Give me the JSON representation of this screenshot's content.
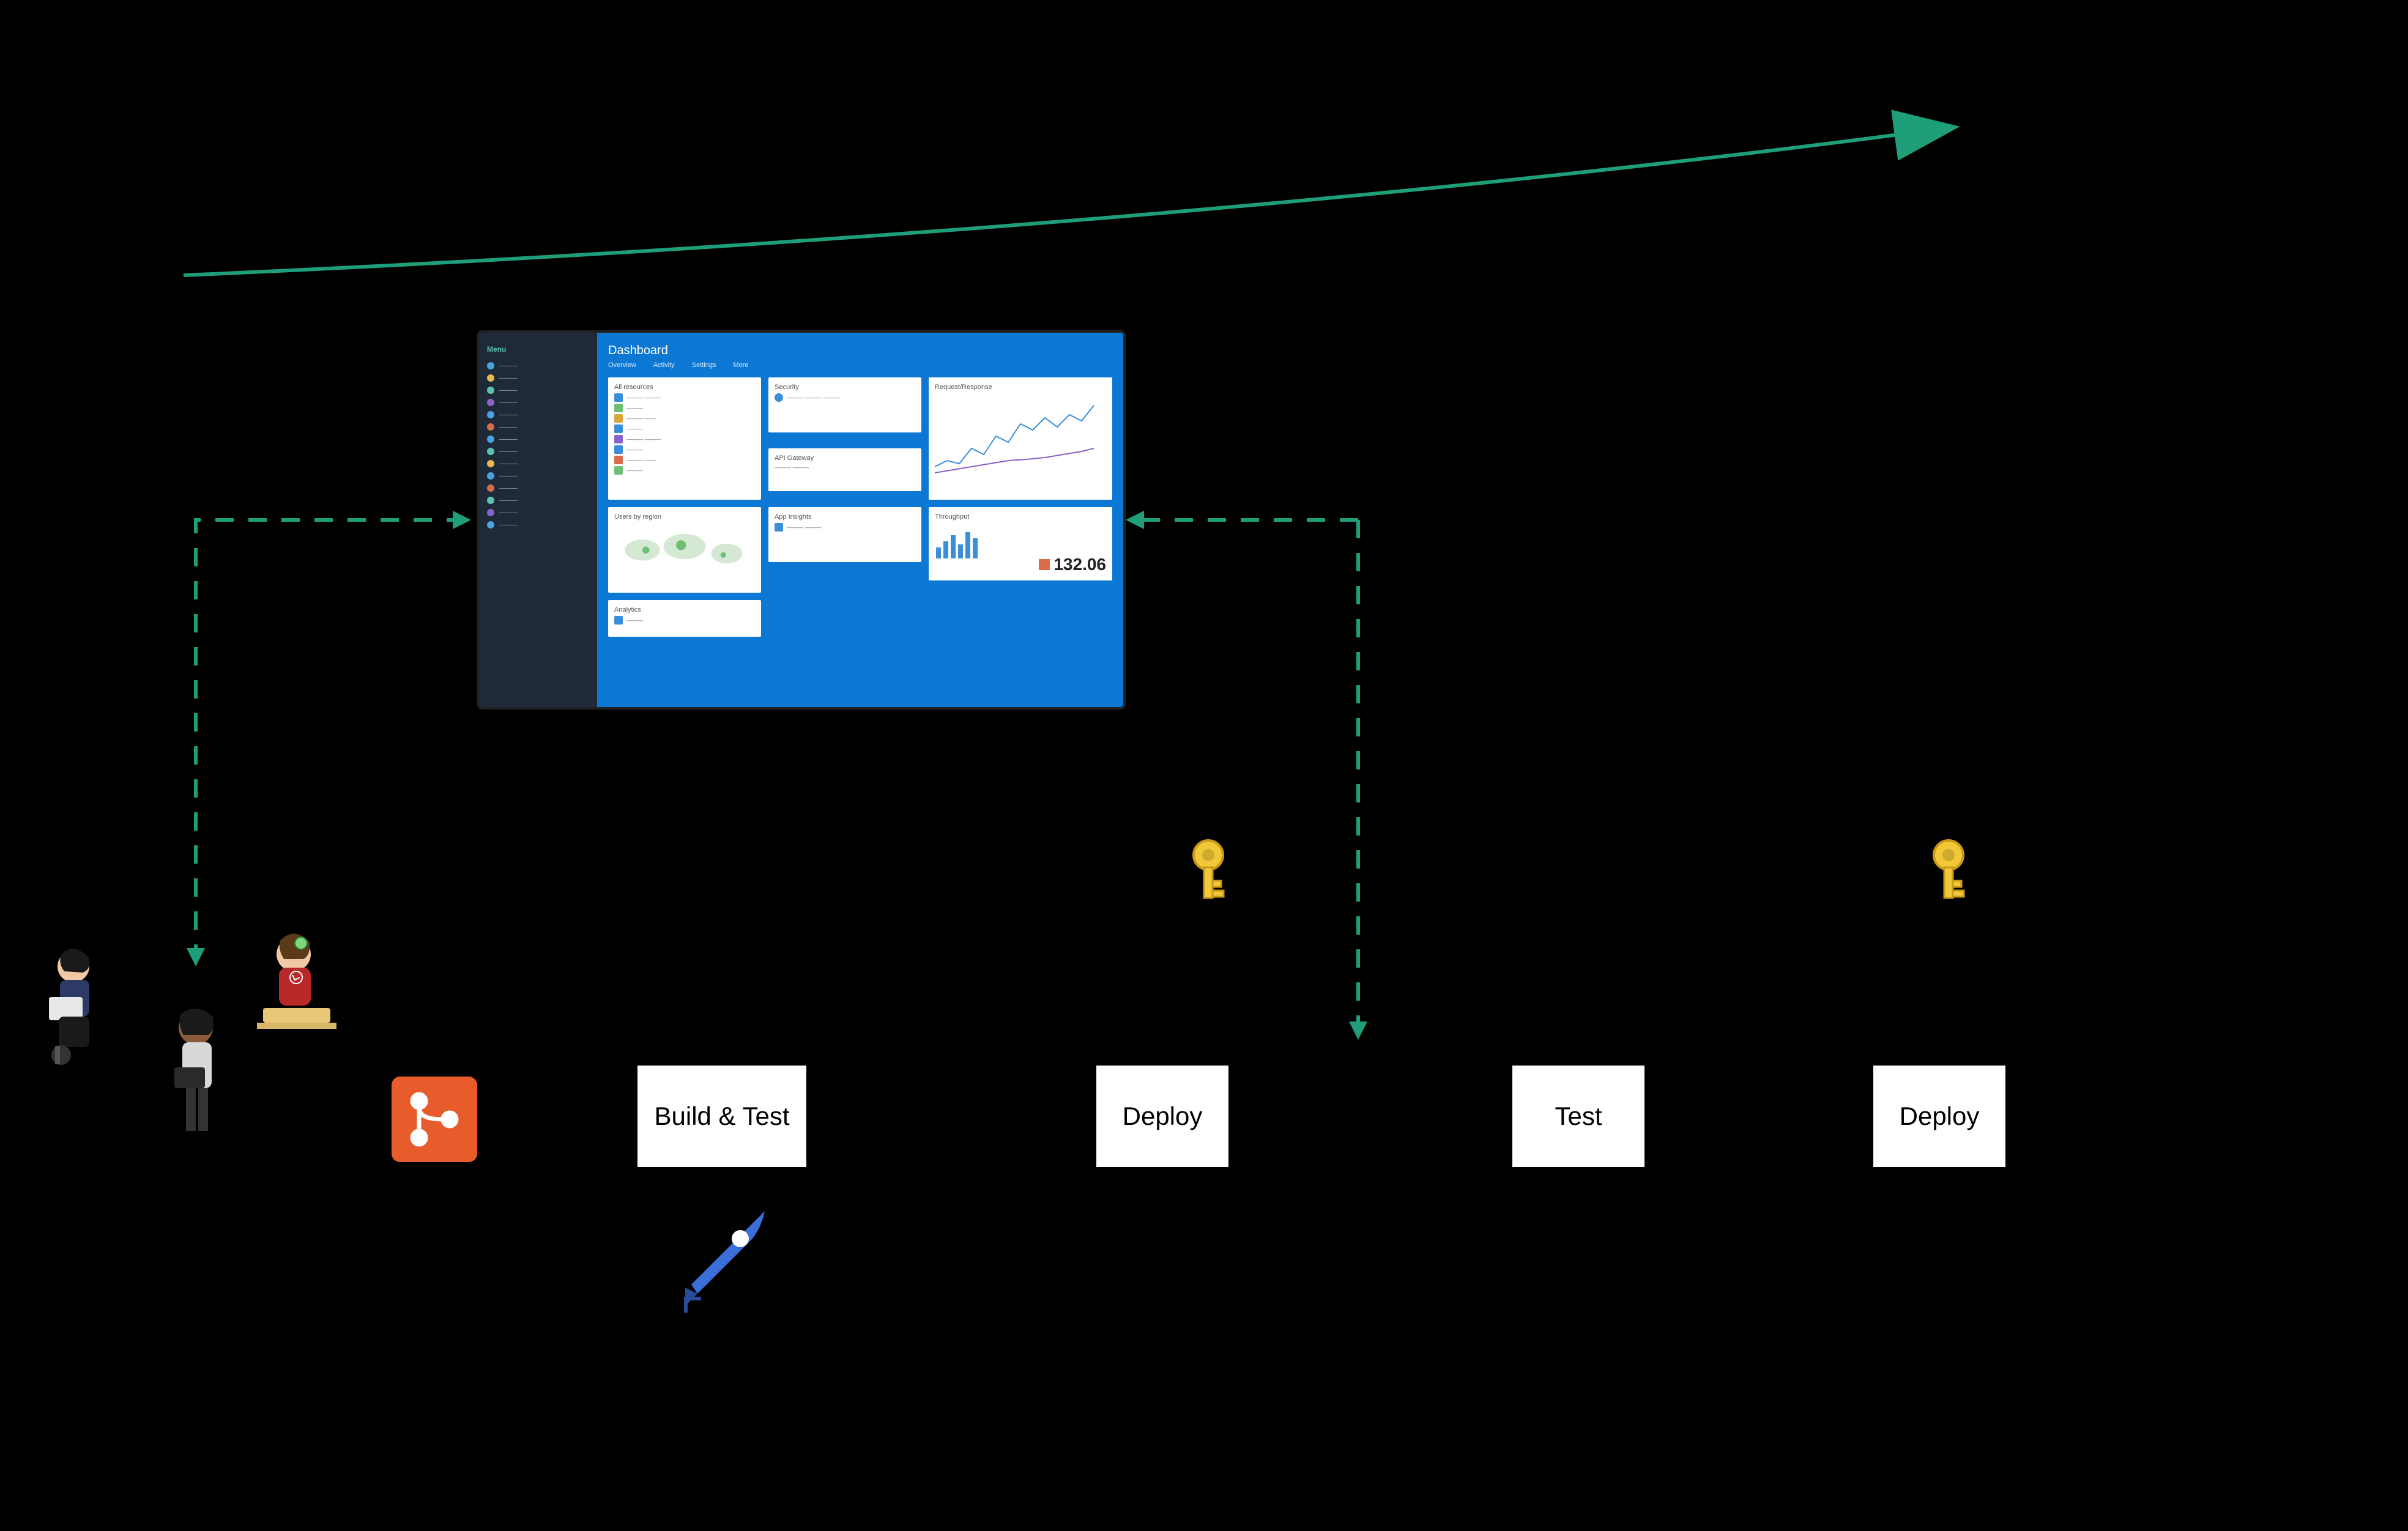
{
  "pipeline": {
    "buildTest": "Build & Test",
    "deployQa": "Deploy",
    "test": "Test",
    "deployProd": "Deploy"
  },
  "dashboard": {
    "title": "Dashboard",
    "sidebar_heading": "Menu",
    "tabs": [
      "Overview",
      "Activity",
      "Settings",
      "More"
    ],
    "tiles": {
      "resources": "All resources",
      "security": "Security",
      "apiGateway": "API Gateway",
      "appInsights": "App Insights",
      "requests": "Request/Response",
      "response": "Throughput",
      "usersMap": "Users by region",
      "analytics": "Analytics",
      "metric": "132.06"
    }
  },
  "icons": {
    "key": "key",
    "git": "git",
    "rocket": "azure-pipelines"
  }
}
